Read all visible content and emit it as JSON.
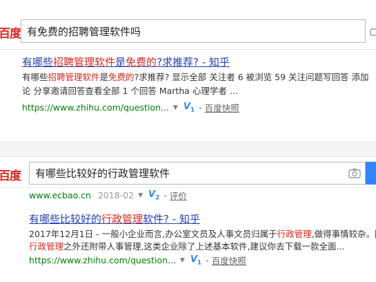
{
  "panel1": {
    "logo": "百度",
    "query": "有免费的招聘管理软件吗",
    "result": {
      "title_parts": [
        {
          "text": "有哪些",
          "hl": false
        },
        {
          "text": "招聘管理软件",
          "hl": true
        },
        {
          "text": "是",
          "hl": false
        },
        {
          "text": "免费的",
          "hl": true
        },
        {
          "text": "?求推荐? - 知乎",
          "hl": false
        }
      ],
      "snippet_line1_parts": [
        {
          "text": "有哪些",
          "hl": false
        },
        {
          "text": "招聘管理软件",
          "hl": true
        },
        {
          "text": "是",
          "hl": false
        },
        {
          "text": "免费的",
          "hl": true
        },
        {
          "text": "?求推荐? 显示全部 关注者 6 被浏览 59 关注问题写回答 添加",
          "hl": false
        }
      ],
      "snippet_line2": "论 分享邀请回答查看全部 1 个回答 Martha 心理学者 ...",
      "url": "https://www.zhihu.com/question...",
      "badge": "V",
      "badge_level": "1",
      "dash": "-",
      "cache": "百度快照"
    }
  },
  "panel2": {
    "logo": "百度",
    "query": "有哪些比较好的行政管理软件",
    "prev_url": "www.ecbao.cn",
    "prev_date": "2018-02",
    "prev_badge": "V",
    "prev_badge_level": "2",
    "prev_dash": "-",
    "prev_rate": "评价",
    "result": {
      "title_parts": [
        {
          "text": "有哪些比较好的",
          "hl": false
        },
        {
          "text": "行政管理",
          "hl": true
        },
        {
          "text": "软件? - 知乎",
          "hl": false
        }
      ],
      "snippet_line1_parts": [
        {
          "text": "2017年12月1日 - 一般小企业而言,办公室文员及人事文员归属于",
          "hl": false
        },
        {
          "text": "行政管理",
          "hl": true
        },
        {
          "text": ",做得事情较杂。除了",
          "hl": false
        }
      ],
      "snippet_line2_parts": [
        {
          "text": "行政管理",
          "hl": true
        },
        {
          "text": "之外还附带人事管理,这类企业除了上述基本软件,建议你去下载一款全面...",
          "hl": false
        }
      ],
      "url": "https://www.zhihu.com/question...",
      "badge": "V",
      "badge_level": "1",
      "dash": "-",
      "cache": "百度快照"
    }
  }
}
